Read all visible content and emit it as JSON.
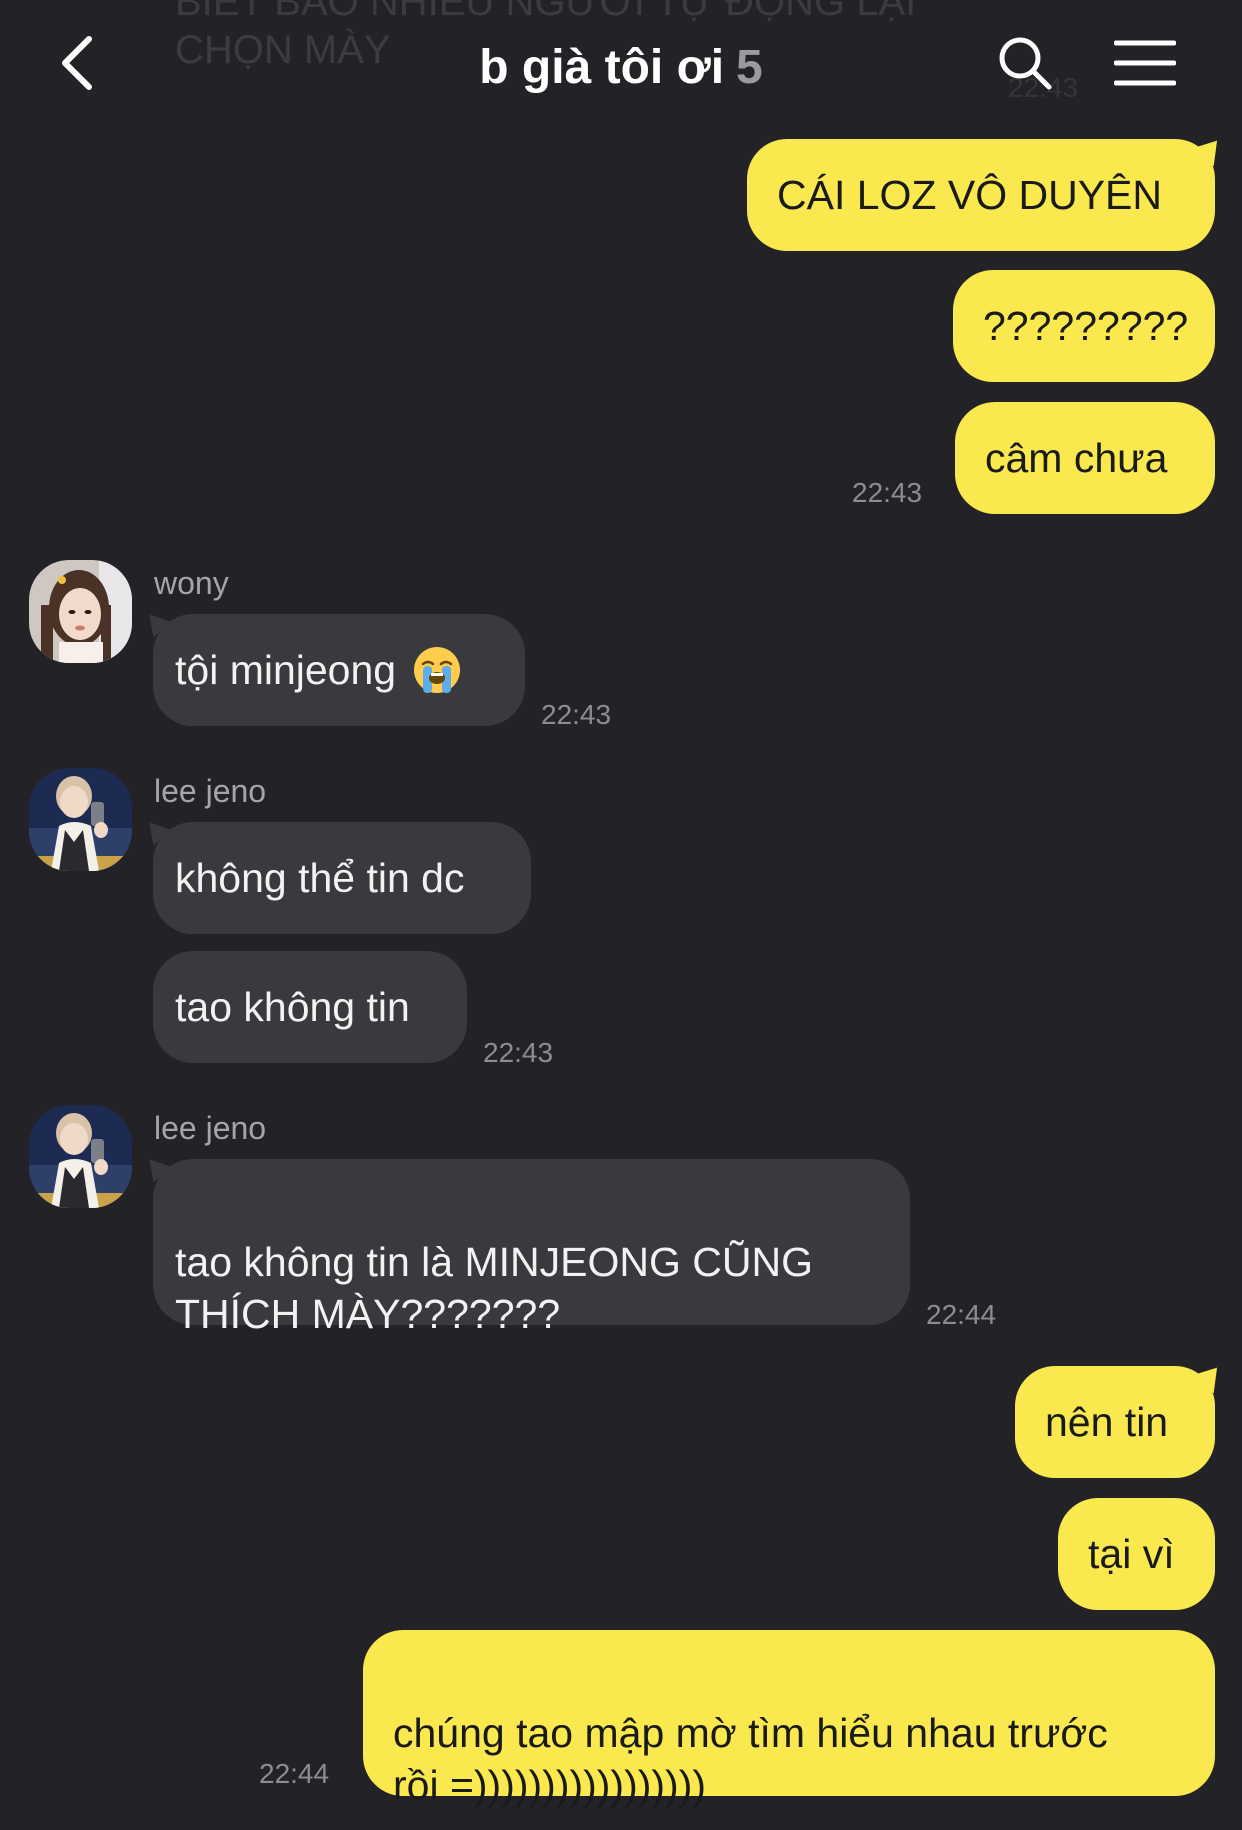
{
  "background_ghost": {
    "text": "BIẾT BAO NHIÊU NGƯỜI TỰ ĐỘNG LẠI\nCHỌN MÀY",
    "time": "22:43"
  },
  "header": {
    "title": "b già tôi ơi",
    "member_count": "5",
    "back_icon": "chevron-left-icon",
    "search_icon": "search-icon",
    "menu_icon": "hamburger-menu-icon"
  },
  "colors": {
    "background": "#232327",
    "my_bubble": "#fae84f",
    "their_bubble": "#3a3a3e",
    "timestamp": "#8c8c92"
  },
  "messages": [
    {
      "from": "me",
      "text": "CÁI LOZ VÔ DUYÊN"
    },
    {
      "from": "me",
      "text": "?????????"
    },
    {
      "from": "me",
      "text": "câm chưa",
      "time": "22:43"
    },
    {
      "from": "wony",
      "sender": "wony",
      "text": "tội minjeong",
      "emoji": "loudly-crying-face-icon",
      "time": "22:43"
    },
    {
      "from": "lee jeno",
      "sender": "lee jeno",
      "text": "không thể tin dc"
    },
    {
      "from": "lee jeno",
      "text": "tao không tin",
      "time": "22:43"
    },
    {
      "from": "lee jeno",
      "sender": "lee jeno",
      "text": "tao không tin là MINJEONG CŨNG\nTHÍCH MÀY???????",
      "time": "22:44"
    },
    {
      "from": "me",
      "text": "nên tin"
    },
    {
      "from": "me",
      "text": "tại vì"
    },
    {
      "from": "me",
      "text": "chúng tao mập mờ tìm hiểu nhau trước\nrồi =)))))))))))))))))",
      "time": "22:44"
    }
  ]
}
